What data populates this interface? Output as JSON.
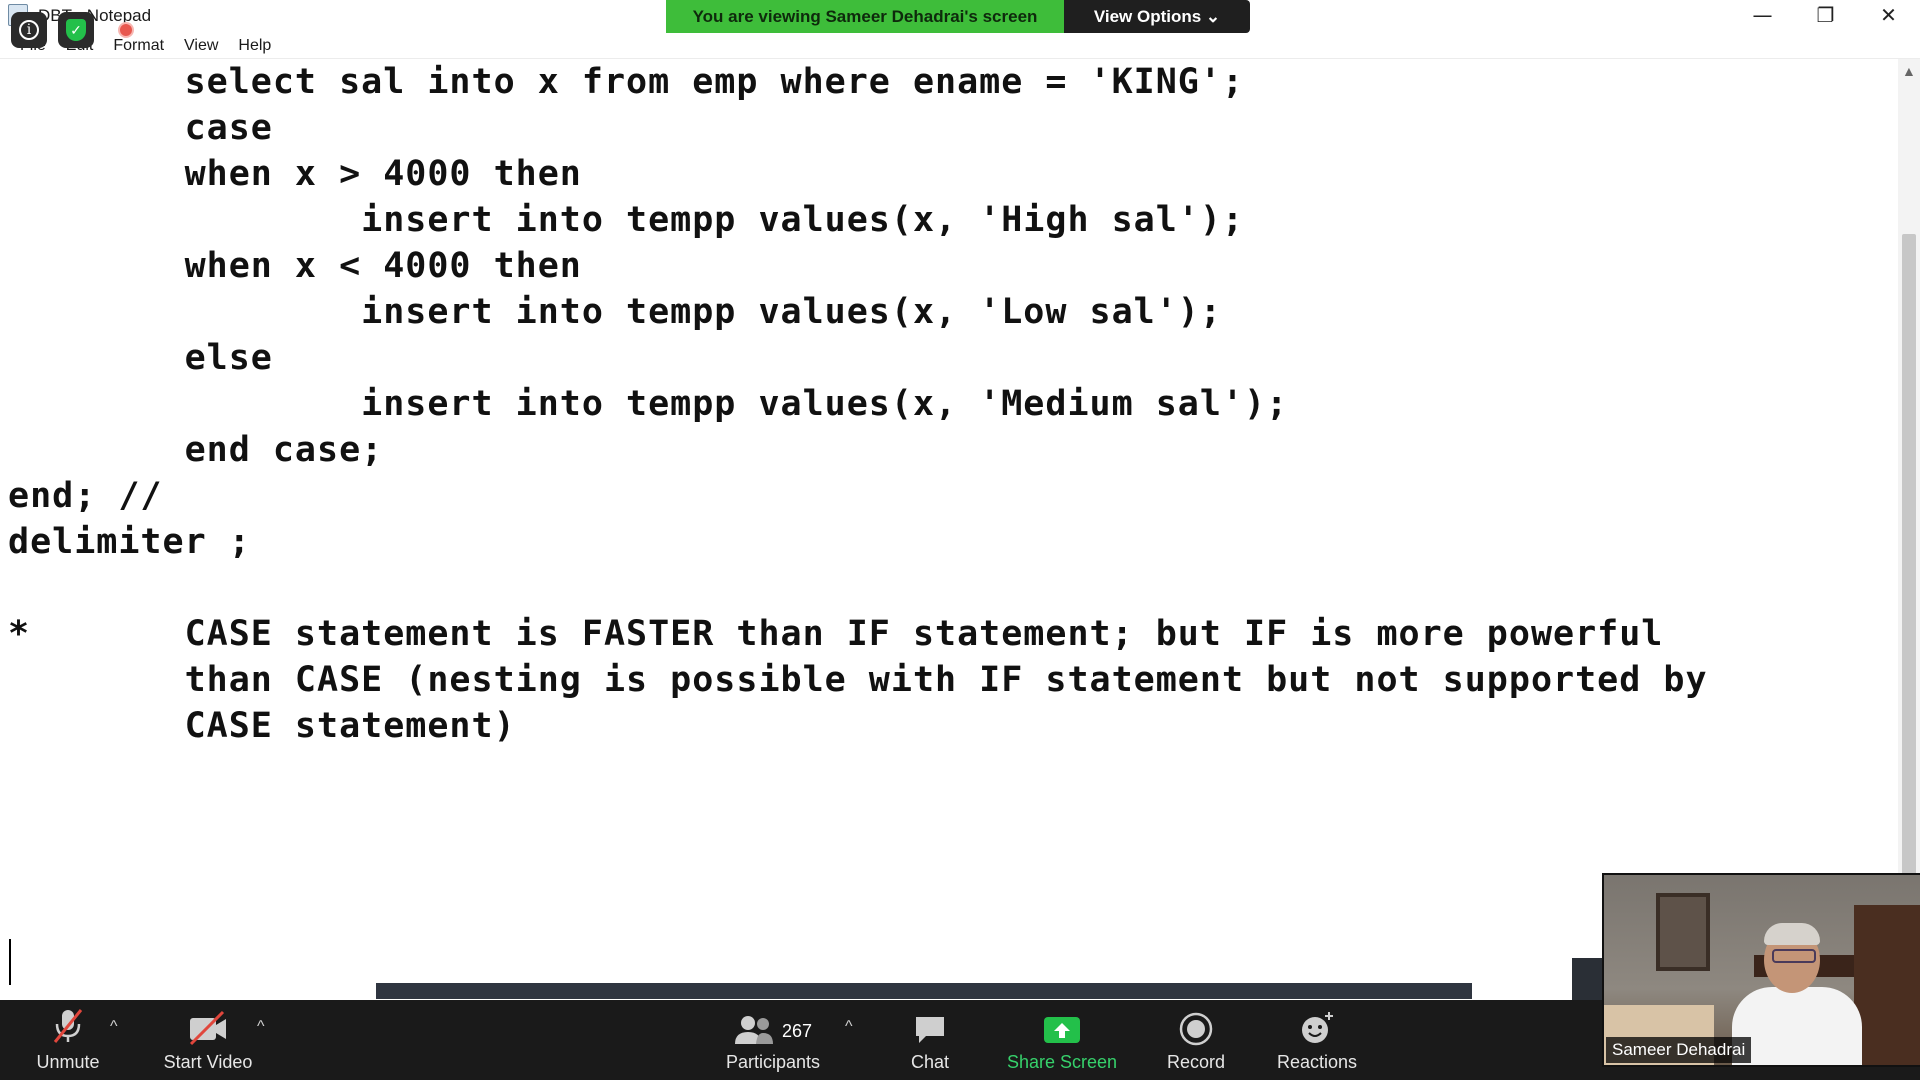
{
  "window": {
    "title": "DBT - Notepad",
    "menu": [
      "File",
      "Edit",
      "Format",
      "View",
      "Help"
    ],
    "controls": {
      "minimize": "—",
      "restore": "❐",
      "close": "✕"
    }
  },
  "banner": {
    "text": "You are viewing Sameer Dehadrai's screen",
    "view_options": "View Options ⌄"
  },
  "editor": {
    "lines": [
      "        select sal into x from emp where ename = 'KING';",
      "        case",
      "        when x > 4000 then",
      "                insert into tempp values(x, 'High sal');",
      "        when x < 4000 then",
      "                insert into tempp values(x, 'Low sal');",
      "        else",
      "                insert into tempp values(x, 'Medium sal');",
      "        end case;",
      "end; //",
      "delimiter ;",
      "",
      "*       CASE statement is FASTER than IF statement; but IF is more powerful",
      "        than CASE (nesting is possible with IF statement but not supported by",
      "        CASE statement)"
    ]
  },
  "toolbar": {
    "unmute": "Unmute",
    "start_video": "Start Video",
    "participants": "Participants",
    "participant_count": "267",
    "chat": "Chat",
    "share_screen": "Share Screen",
    "record": "Record",
    "reactions": "Reactions",
    "caret": "^"
  },
  "video": {
    "name": "Sameer Dehadrai"
  },
  "colors": {
    "banner_green": "#3ebd3a",
    "share_green": "#23c04a",
    "toolbar_bg": "#1a1a1a"
  }
}
